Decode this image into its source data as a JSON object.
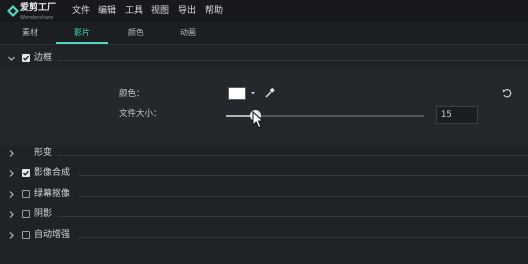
{
  "app": {
    "name": "爱剪工厂",
    "sub": "Wondershare"
  },
  "menu": [
    "文件",
    "编辑",
    "工具",
    "视图",
    "导出",
    "帮助"
  ],
  "tabs": {
    "items": [
      "素材",
      "影片",
      "颜色",
      "动画"
    ],
    "active": "影片"
  },
  "border_section": {
    "label": "边框",
    "checked": true,
    "expanded": true,
    "color_label": "颜色：",
    "color_value": "#ffffff",
    "size_label": "文件大小：",
    "size_value": "15",
    "size_fraction": 0.15
  },
  "sections": [
    {
      "label": "形变",
      "checkbox": false,
      "checked": false
    },
    {
      "label": "影像合成",
      "checkbox": true,
      "checked": true
    },
    {
      "label": "绿幕抠像",
      "checkbox": true,
      "checked": false
    },
    {
      "label": "阴影",
      "checkbox": true,
      "checked": false
    },
    {
      "label": "自动增强",
      "checkbox": true,
      "checked": false
    }
  ],
  "colors": {
    "accent": "#4fd6c0",
    "background": "#1f2226",
    "menubar": "#17191c"
  },
  "icons": [
    "app-logo-icon",
    "chevron-down-icon",
    "chevron-right-icon",
    "eyedropper-icon",
    "reset-icon",
    "dropdown-arrow-icon",
    "mouse-cursor-icon"
  ]
}
